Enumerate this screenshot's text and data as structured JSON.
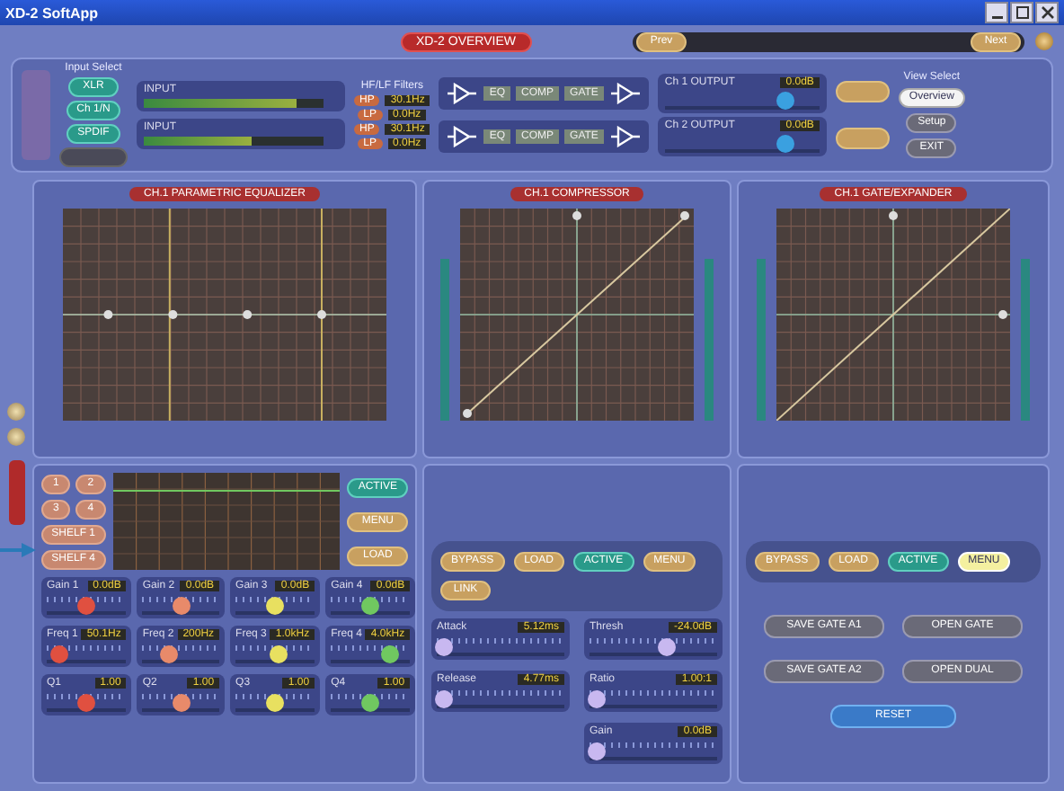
{
  "window": {
    "title": "XD-2 SoftApp"
  },
  "overview_tab": {
    "label": "XD-2 OVERVIEW"
  },
  "preset_bar": {
    "buttons": [
      {
        "label": "Prev"
      },
      {
        "label": "Next"
      }
    ]
  },
  "input_select": {
    "label": "Input Select",
    "buttons": [
      {
        "label": "XLR",
        "selected": true
      },
      {
        "label": "Ch 1/N",
        "selected": true
      },
      {
        "label": "SPDIF",
        "selected": true
      },
      {
        "selected": false
      }
    ]
  },
  "input_meters": [
    {
      "label": "INPUT",
      "level": 0.85
    },
    {
      "label": "INPUT",
      "level": 0.6
    }
  ],
  "filters": {
    "label": "HF/LF Filters",
    "rows": [
      {
        "badge": "HP",
        "value": "30.1Hz"
      },
      {
        "badge": "LP",
        "value": "0.0Hz"
      },
      {
        "badge": "HP",
        "value": "30.1Hz"
      },
      {
        "badge": "LP",
        "value": "0.0Hz"
      }
    ]
  },
  "chains": [
    {
      "blocks": [
        "EQ",
        "COMP",
        "GATE"
      ]
    },
    {
      "blocks": [
        "EQ",
        "COMP",
        "GATE"
      ]
    }
  ],
  "outputs": [
    {
      "label": "Ch 1 OUTPUT",
      "value": "0.0dB",
      "level": 0.78
    },
    {
      "label": "Ch 2 OUTPUT",
      "value": "0.0dB",
      "level": 0.78
    }
  ],
  "view_select": {
    "label": "View Select",
    "buttons": [
      {
        "label": "Overview",
        "selected": true
      },
      {
        "label": "Setup",
        "selected": false
      },
      {
        "label": "EXIT",
        "selected": false
      }
    ]
  },
  "panels": [
    {
      "kind": "eq",
      "title": "CH.1 PARAMETRIC EQUALIZER"
    },
    {
      "kind": "comp",
      "title": "CH.1 COMPRESSOR"
    },
    {
      "kind": "gate",
      "title": "CH.1 GATE/EXPANDER"
    }
  ],
  "eq_controls": {
    "buttons": [
      {
        "label": "1"
      },
      {
        "label": "2"
      },
      {
        "label": "3"
      },
      {
        "label": "4"
      },
      {
        "label": "SHELF 1"
      },
      {
        "label": "SHELF 4"
      }
    ],
    "side_buttons": [
      {
        "label": "ACTIVE",
        "selected": true
      },
      {
        "label": "MENU",
        "selected": false
      },
      {
        "label": "LOAD",
        "selected": false
      }
    ],
    "sliders": [
      {
        "label": "Gain 1",
        "value": "0.0dB",
        "level": 0.5,
        "color": "#e05040"
      },
      {
        "label": "Gain 2",
        "value": "0.0dB",
        "level": 0.5,
        "color": "#e88a6a"
      },
      {
        "label": "Gain 3",
        "value": "0.0dB",
        "level": 0.5,
        "color": "#e8e060"
      },
      {
        "label": "Gain 4",
        "value": "0.0dB",
        "level": 0.5,
        "color": "#70c860"
      },
      {
        "label": "Freq 1",
        "value": "50.1Hz",
        "level": 0.15,
        "color": "#e05040"
      },
      {
        "label": "Freq 2",
        "value": "200Hz",
        "level": 0.35,
        "color": "#e88a6a"
      },
      {
        "label": "Freq 3",
        "value": "1.0kHz",
        "level": 0.55,
        "color": "#e8e060"
      },
      {
        "label": "Freq 4",
        "value": "4.0kHz",
        "level": 0.75,
        "color": "#70c860"
      },
      {
        "label": "Q1",
        "value": "1.00",
        "level": 0.5,
        "color": "#e05040"
      },
      {
        "label": "Q2",
        "value": "1.00",
        "level": 0.5,
        "color": "#e88a6a"
      },
      {
        "label": "Q3",
        "value": "1.00",
        "level": 0.5,
        "color": "#e8e060"
      },
      {
        "label": "Q4",
        "value": "1.00",
        "level": 0.5,
        "color": "#70c860"
      }
    ]
  },
  "comp_controls": {
    "buttons": [
      {
        "label": "BYPASS",
        "selected": false
      },
      {
        "label": "LOAD",
        "selected": false
      },
      {
        "label": "ACTIVE",
        "selected": true
      },
      {
        "label": "MENU",
        "selected": false
      },
      {
        "label": "LINK",
        "selected": false
      }
    ],
    "sliders": [
      {
        "label": "Attack",
        "value": "5.12ms",
        "level": 0.05
      },
      {
        "label": "Thresh",
        "value": "-24.0dB",
        "level": 0.6
      },
      {
        "label": "Release",
        "value": "4.77ms",
        "level": 0.05
      },
      {
        "label": "Ratio",
        "value": "1.00:1",
        "level": 0.05
      },
      {
        "label": "Gain",
        "value": "0.0dB",
        "level": 0.05
      }
    ]
  },
  "gate_controls": {
    "buttons": [
      {
        "label": "BYPASS",
        "selected": false
      },
      {
        "label": "LOAD",
        "selected": false
      },
      {
        "label": "ACTIVE",
        "selected": true
      },
      {
        "label": "MENU",
        "selected": true
      }
    ],
    "actions": [
      {
        "label": "SAVE GATE A1"
      },
      {
        "label": "OPEN GATE"
      },
      {
        "label": "SAVE GATE A2"
      },
      {
        "label": "OPEN DUAL"
      },
      {
        "label": "RESET"
      }
    ]
  }
}
